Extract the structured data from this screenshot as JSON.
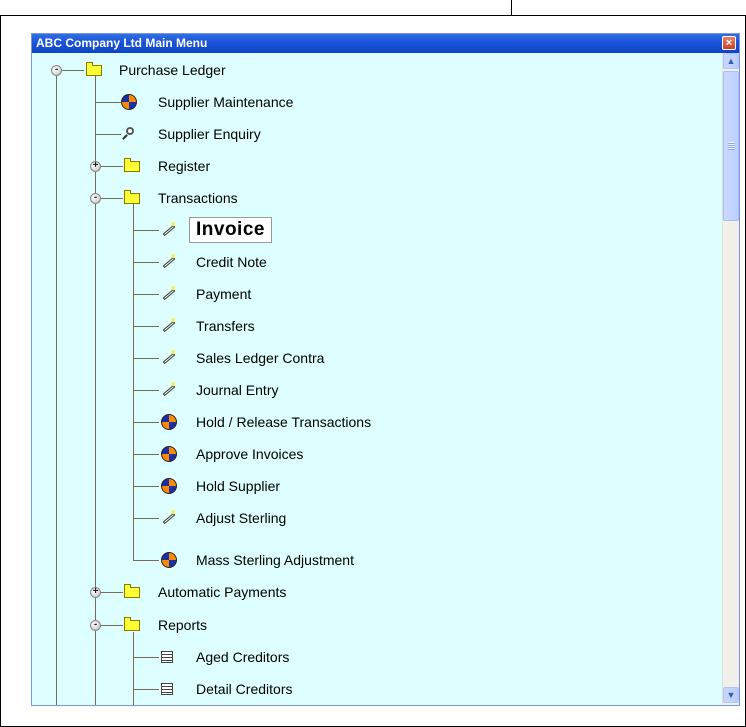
{
  "window": {
    "title": "ABC Company Ltd Main Menu",
    "close_glyph": "×"
  },
  "tree": {
    "root": {
      "label": "Purchase Ledger",
      "icon": "folder-icon",
      "expanded": true
    },
    "supplier_maintenance": {
      "label": "Supplier Maintenance",
      "icon": "globe-icon"
    },
    "supplier_enquiry": {
      "label": "Supplier Enquiry",
      "icon": "magnifier-icon"
    },
    "register": {
      "label": "Register",
      "icon": "folder-icon",
      "expanded": false
    },
    "transactions": {
      "label": "Transactions",
      "icon": "folder-icon",
      "expanded": true,
      "items": [
        {
          "label": "Invoice",
          "icon": "pencil-icon",
          "selected": true
        },
        {
          "label": "Credit Note",
          "icon": "pencil-icon"
        },
        {
          "label": "Payment",
          "icon": "pencil-icon"
        },
        {
          "label": "Transfers",
          "icon": "pencil-icon"
        },
        {
          "label": "Sales Ledger Contra",
          "icon": "pencil-icon"
        },
        {
          "label": "Journal Entry",
          "icon": "pencil-icon"
        },
        {
          "label": "Hold / Release Transactions",
          "icon": "globe-icon"
        },
        {
          "label": "Approve Invoices",
          "icon": "globe-icon"
        },
        {
          "label": "Hold Supplier",
          "icon": "globe-icon"
        },
        {
          "label": "Adjust Sterling",
          "icon": "pencil-icon"
        },
        {
          "label": "Mass Sterling Adjustment",
          "icon": "globe-icon"
        }
      ]
    },
    "automatic_payments": {
      "label": "Automatic Payments",
      "icon": "folder-icon",
      "expanded": false
    },
    "reports": {
      "label": "Reports",
      "icon": "folder-icon",
      "expanded": true,
      "items": [
        {
          "label": "Aged Creditors",
          "icon": "report-icon"
        },
        {
          "label": "Detail Creditors",
          "icon": "report-icon"
        }
      ]
    }
  },
  "colors": {
    "window_bg": "#ddffff",
    "titlebar": "#1c55d8",
    "folder": "#ffff33"
  }
}
